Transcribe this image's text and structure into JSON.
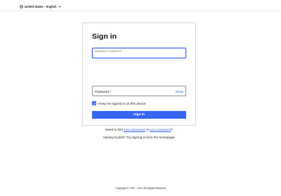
{
  "header": {
    "locale_label": "United States - English"
  },
  "signin": {
    "title": "Sign in",
    "username_placeholder": "Username or Customer ID*",
    "password_label": "Password *",
    "show_label": "Show",
    "keep_signed_in_label": "Keep me signed in on this device",
    "keep_signed_in_checked": true,
    "submit_label": "Sign In"
  },
  "help": {
    "prefix": "Need to find ",
    "username_link": "your username",
    "middle": " or ",
    "password_link": "your password",
    "suffix": "?",
    "trouble_text": "Having trouble? Try signing in from the homepage."
  },
  "footer": {
    "copyright": "Copyright © 1999 - 2022 All Rights Reserved"
  },
  "colors": {
    "accent": "#3665f3",
    "border": "#d6d6d6"
  }
}
